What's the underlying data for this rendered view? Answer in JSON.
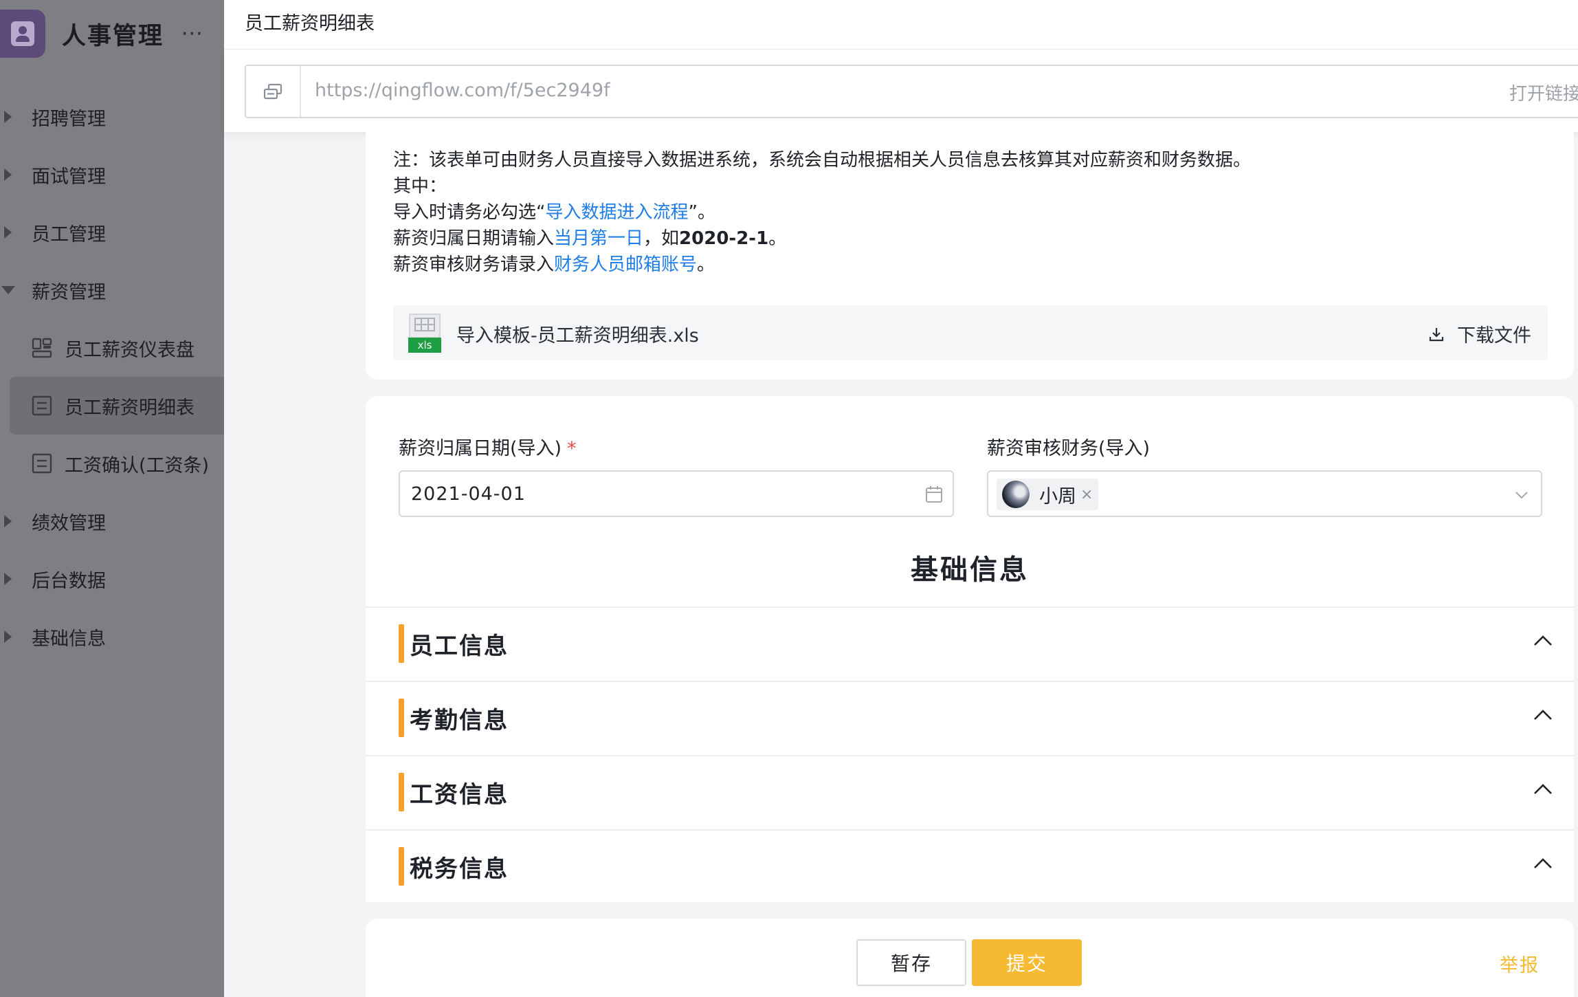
{
  "app": {
    "title": "人事管理",
    "more": "···"
  },
  "sidebar": {
    "items": [
      {
        "label": "招聘管理",
        "expanded": false
      },
      {
        "label": "面试管理",
        "expanded": false
      },
      {
        "label": "员工管理",
        "expanded": false
      },
      {
        "label": "薪资管理",
        "expanded": true,
        "children": [
          {
            "label": "员工薪资仪表盘",
            "icon": "dashboard-icon"
          },
          {
            "label": "员工薪资明细表",
            "icon": "form-icon",
            "active": true
          },
          {
            "label": "工资确认(工资条)",
            "icon": "form-icon"
          }
        ]
      },
      {
        "label": "绩效管理",
        "expanded": false
      },
      {
        "label": "后台数据",
        "expanded": false
      },
      {
        "label": "基础信息",
        "expanded": false
      }
    ]
  },
  "header": {
    "title": "员工薪资明细表"
  },
  "link": {
    "url": "https://qingflow.com/f/5ec2949f",
    "open_label": "打开链接",
    "copy_label": "复"
  },
  "note": {
    "line1": "注：该表单可由财务人员直接导入数据进系统，系统会自动根据相关人员信息去核算其对应薪资和财务数据。",
    "line2": "其中：",
    "line3_pre": "导入时请务必勾选“",
    "line3_hl": "导入数据进入流程",
    "line3_post": "”。",
    "line4_pre": "薪资归属日期请输入",
    "line4_hl": "当月第一日",
    "line4_mid": "，如",
    "line4_bold": "2020-2-1",
    "line4_post": "。",
    "line5_pre": "薪资审核财务请录入",
    "line5_hl": "财务人员邮箱账号",
    "line5_post": "。"
  },
  "attachment": {
    "file_badge": "xls",
    "file_name": "导入模板-员工薪资明细表.xls",
    "download_label": "下载文件"
  },
  "form": {
    "date_field": {
      "label": "薪资归属日期(导入)",
      "required_mark": "*",
      "value": "2021-04-01"
    },
    "finance_field": {
      "label": "薪资审核财务(导入)",
      "tag_name": "小周",
      "tag_remove": "×"
    },
    "section_heading": "基础信息",
    "groups": [
      {
        "title": "员工信息"
      },
      {
        "title": "考勤信息"
      },
      {
        "title": "工资信息"
      },
      {
        "title": "税务信息"
      }
    ]
  },
  "actions": {
    "save_label": "暂存",
    "submit_label": "提交",
    "report_label": "举报"
  },
  "colors": {
    "accent_orange": "#f5b932",
    "section_bar": "#f59f2b",
    "link_blue": "#1e7ee6",
    "required_red": "#e5484d"
  }
}
